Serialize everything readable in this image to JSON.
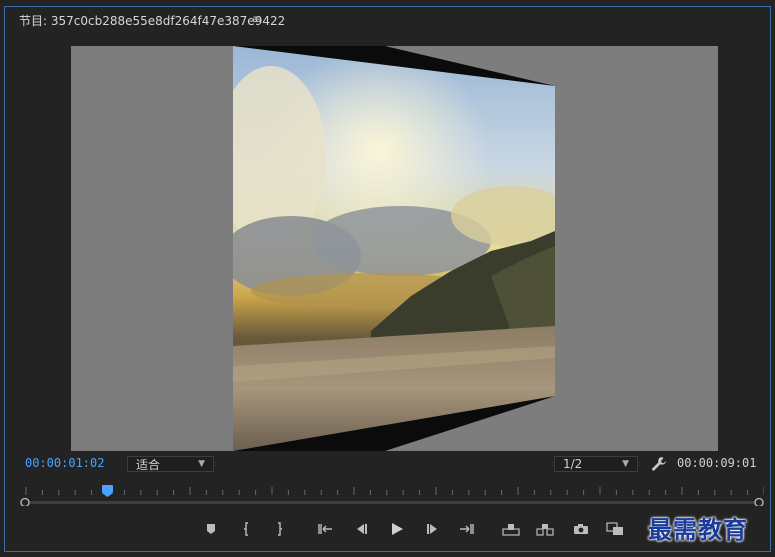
{
  "header": {
    "title": "节目: 357c0cb288e55e8df264f47e387e9422",
    "menu_icon": "hamburger-menu-icon"
  },
  "viewer": {
    "background": "#7d7d7d",
    "content": "landscape clip with rotated 3D transform"
  },
  "toolbar": {
    "current_timecode": "00:00:01:02",
    "fit_label": "适合",
    "resolution_label": "1/2",
    "settings_icon": "wrench-icon",
    "duration_timecode": "00:00:09:01"
  },
  "colors": {
    "accent": "#4aa3ff",
    "panel_border": "#3a6ea5",
    "background": "#232323"
  },
  "transport": {
    "icons": [
      "add-marker-icon",
      "mark-in-icon",
      "mark-out-icon",
      "go-to-in-icon",
      "step-back-icon",
      "play-icon",
      "step-forward-icon",
      "go-to-out-icon",
      "lift-icon",
      "extract-icon",
      "export-frame-icon",
      "compare-view-icon"
    ]
  },
  "watermark": {
    "text": "最需教育"
  }
}
